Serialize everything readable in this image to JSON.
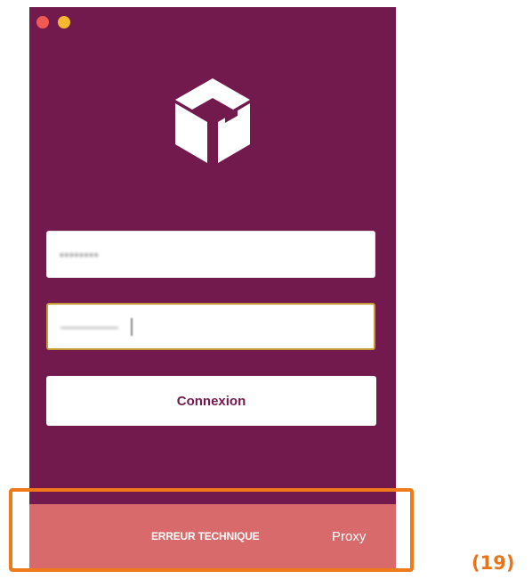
{
  "window": {
    "controls": {
      "close_color": "#f05a52",
      "minimize_color": "#f5b82e"
    },
    "background_color": "#721a4d"
  },
  "logo": {
    "icon": "parcel-box-icon"
  },
  "login_form": {
    "username_value": "••••••••",
    "password_value": "—————",
    "connect_label": "Connexion"
  },
  "status_bar": {
    "error_text": "ERREUR TECHNIQUE",
    "proxy_label": "Proxy",
    "background_color": "#d86a6c"
  },
  "annotation": {
    "label": "(19)",
    "highlight_color": "#f07a1a"
  }
}
